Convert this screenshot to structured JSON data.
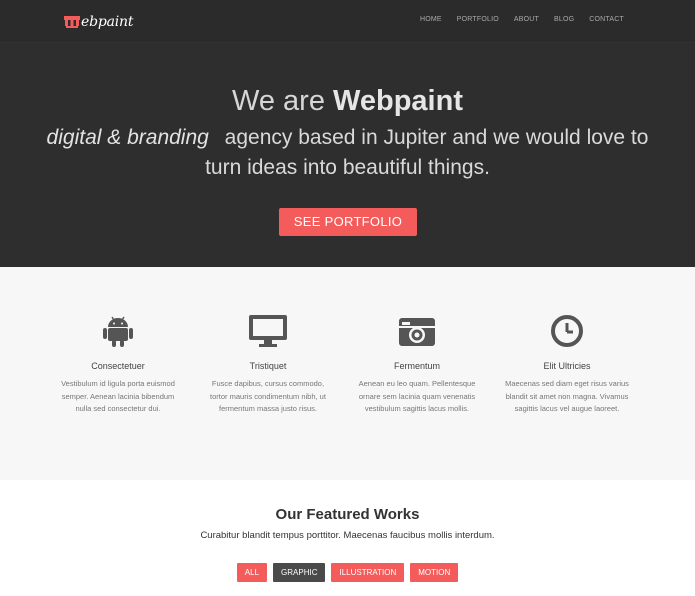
{
  "header": {
    "logo_text": "ebpaint",
    "nav": [
      "HOME",
      "PORTFOLIO",
      "ABOUT",
      "BLOG",
      "CONTACT"
    ]
  },
  "hero": {
    "title_prefix": "We are ",
    "title_brand": "Webpaint",
    "sub_italic": "digital & branding",
    "sub_line1": "agency based in Jupiter and we would love to",
    "sub_line2": "turn ideas into beautiful things.",
    "cta_label": "SEE PORTFOLIO"
  },
  "features": [
    {
      "icon": "android-icon",
      "title": "Consectetuer",
      "text": "Vestibulum id ligula porta euismod semper. Aenean lacinia bibendum nulla sed consectetur dui."
    },
    {
      "icon": "monitor-icon",
      "title": "Tristiquet",
      "text": "Fusce dapibus, cursus commodo, tortor mauris condimentum nibh, ut fermentum massa justo risus."
    },
    {
      "icon": "camera-icon",
      "title": "Fermentum",
      "text": "Aenean eu leo quam. Pellentesque ornare sem lacinia quam venenatis vestibulum sagittis lacus mollis."
    },
    {
      "icon": "clock-icon",
      "title": "Elit Ultricies",
      "text": "Maecenas sed diam eget risus varius blandit sit amet non magna. Vivamus sagittis lacus vel augue laoreet."
    }
  ],
  "works": {
    "title": "Our Featured Works",
    "subtitle": "Curabitur blandit tempus porttitor. Maecenas faucibus mollis interdum.",
    "filters": [
      "ALL",
      "GRAPHIC",
      "ILLUSTRATION",
      "MOTION"
    ],
    "active_filter": "GRAPHIC"
  },
  "colors": {
    "accent": "#f45c5c",
    "dark": "#2e2e2e",
    "light_bg": "#f7f7f7"
  }
}
